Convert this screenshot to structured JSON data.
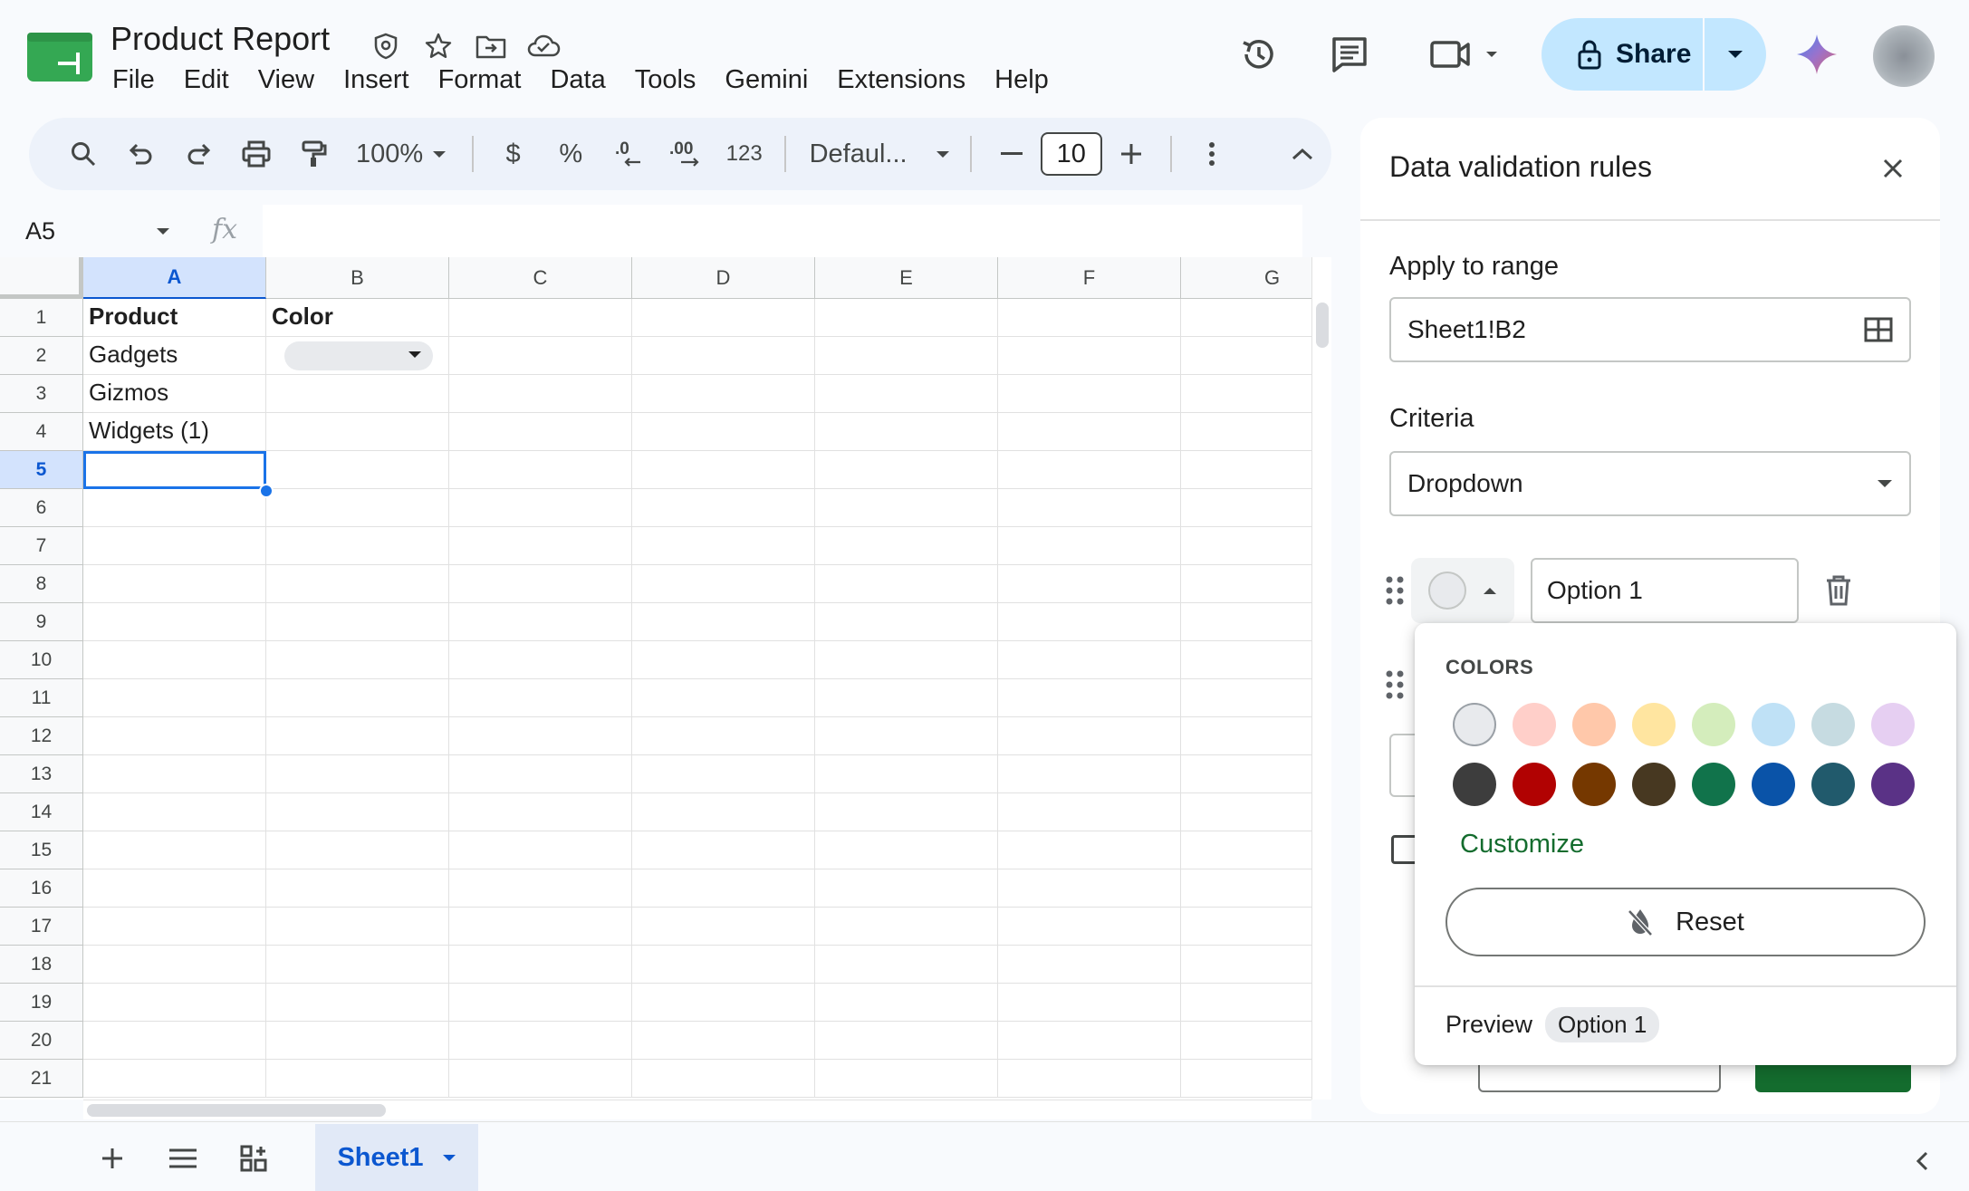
{
  "app": {
    "title": "Product Report",
    "brand_color": "#34a853"
  },
  "menu": [
    "File",
    "Edit",
    "View",
    "Insert",
    "Format",
    "Data",
    "Tools",
    "Gemini",
    "Extensions",
    "Help"
  ],
  "header": {
    "share_label": "Share",
    "icons": [
      "history-icon",
      "comment-icon",
      "meet-icon",
      "lock-icon",
      "gemini-icon"
    ]
  },
  "toolbar": {
    "zoom": "100%",
    "currency": "$",
    "percent": "%",
    "decrease_decimal": ".0",
    "increase_decimal": ".00",
    "number_format": "123",
    "font": "Defaul...",
    "font_size": "10"
  },
  "formula_bar": {
    "name_box": "A5",
    "fx": "fx",
    "value": ""
  },
  "grid": {
    "columns": [
      "A",
      "B",
      "C",
      "D",
      "E",
      "F",
      "G"
    ],
    "selected_column": "A",
    "selected_row": 5,
    "rows": [
      {
        "n": "1",
        "cells": [
          "Product",
          "Color",
          "",
          "",
          "",
          "",
          ""
        ]
      },
      {
        "n": "2",
        "cells": [
          "Gadgets",
          "",
          "",
          "",
          "",
          "",
          ""
        ]
      },
      {
        "n": "3",
        "cells": [
          "Gizmos",
          "",
          "",
          "",
          "",
          "",
          ""
        ]
      },
      {
        "n": "4",
        "cells": [
          "Widgets (1)",
          "",
          "",
          "",
          "",
          "",
          ""
        ]
      },
      {
        "n": "5",
        "cells": [
          "",
          "",
          "",
          "",
          "",
          "",
          ""
        ]
      },
      {
        "n": "6",
        "cells": [
          "",
          "",
          "",
          "",
          "",
          "",
          ""
        ]
      },
      {
        "n": "7",
        "cells": [
          "",
          "",
          "",
          "",
          "",
          "",
          ""
        ]
      },
      {
        "n": "8",
        "cells": [
          "",
          "",
          "",
          "",
          "",
          "",
          ""
        ]
      },
      {
        "n": "9",
        "cells": [
          "",
          "",
          "",
          "",
          "",
          "",
          ""
        ]
      },
      {
        "n": "10",
        "cells": [
          "",
          "",
          "",
          "",
          "",
          "",
          ""
        ]
      },
      {
        "n": "11",
        "cells": [
          "",
          "",
          "",
          "",
          "",
          "",
          ""
        ]
      },
      {
        "n": "12",
        "cells": [
          "",
          "",
          "",
          "",
          "",
          "",
          ""
        ]
      },
      {
        "n": "13",
        "cells": [
          "",
          "",
          "",
          "",
          "",
          "",
          ""
        ]
      },
      {
        "n": "14",
        "cells": [
          "",
          "",
          "",
          "",
          "",
          "",
          ""
        ]
      },
      {
        "n": "15",
        "cells": [
          "",
          "",
          "",
          "",
          "",
          "",
          ""
        ]
      },
      {
        "n": "16",
        "cells": [
          "",
          "",
          "",
          "",
          "",
          "",
          ""
        ]
      },
      {
        "n": "17",
        "cells": [
          "",
          "",
          "",
          "",
          "",
          "",
          ""
        ]
      },
      {
        "n": "18",
        "cells": [
          "",
          "",
          "",
          "",
          "",
          "",
          ""
        ]
      },
      {
        "n": "19",
        "cells": [
          "",
          "",
          "",
          "",
          "",
          "",
          ""
        ]
      },
      {
        "n": "20",
        "cells": [
          "",
          "",
          "",
          "",
          "",
          "",
          ""
        ]
      },
      {
        "n": "21",
        "cells": [
          "",
          "",
          "",
          "",
          "",
          "",
          ""
        ]
      }
    ]
  },
  "bottom": {
    "sheet_tab": "Sheet1"
  },
  "panel": {
    "title": "Data validation rules",
    "apply_label": "Apply to range",
    "range_value": "Sheet1!B2",
    "criteria_label": "Criteria",
    "criteria_value": "Dropdown",
    "option1_value": "Option 1"
  },
  "color_popup": {
    "heading": "COLORS",
    "light_colors": [
      "#e8eaed",
      "#ffcfc9",
      "#ffc8aa",
      "#ffe5a0",
      "#d4edbc",
      "#bfe1f6",
      "#c6dbe1",
      "#e6cff2"
    ],
    "dark_colors": [
      "#3d3d3d",
      "#b10202",
      "#753800",
      "#473821",
      "#11734b",
      "#0a53a8",
      "#215a6c",
      "#5a3286"
    ],
    "customize_label": "Customize",
    "reset_label": "Reset",
    "preview_label": "Preview",
    "preview_chip": "Option 1"
  }
}
